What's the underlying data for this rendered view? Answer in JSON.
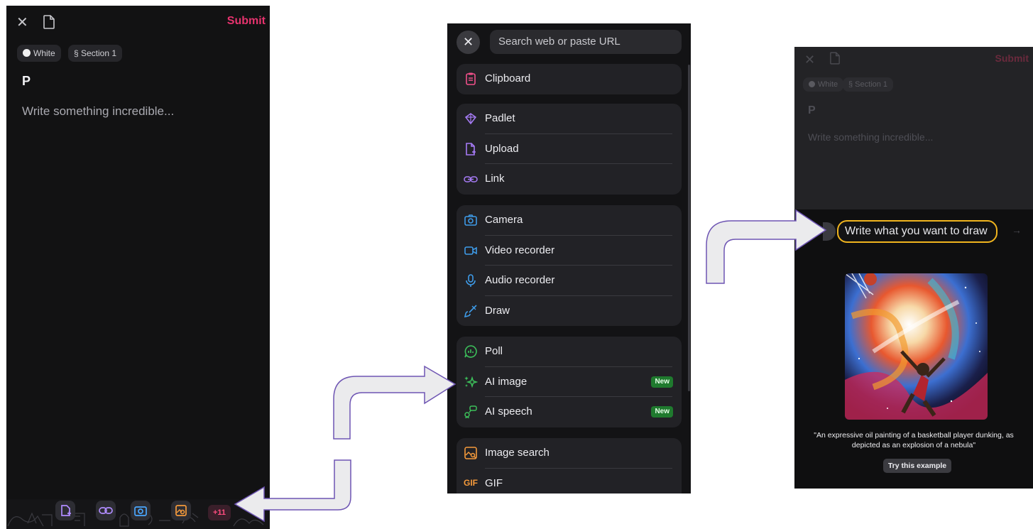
{
  "editor": {
    "submit_label": "Submit",
    "color_chip": "White",
    "section_chip": "§ Section 1",
    "title": "P",
    "body_placeholder": "Write something incredible...",
    "more_badge": "+11"
  },
  "menu": {
    "search_placeholder": "Search web or paste URL",
    "groups": [
      {
        "items": [
          {
            "label": "Clipboard",
            "icon": "clipboard-icon",
            "color": "#f0508a"
          }
        ]
      },
      {
        "items": [
          {
            "label": "Padlet",
            "icon": "padlet-icon",
            "color": "#a67bf5"
          },
          {
            "label": "Upload",
            "icon": "upload-icon",
            "color": "#a67bf5"
          },
          {
            "label": "Link",
            "icon": "link-icon",
            "color": "#a67bf5"
          }
        ]
      },
      {
        "items": [
          {
            "label": "Camera",
            "icon": "camera-icon",
            "color": "#3e9be8"
          },
          {
            "label": "Video recorder",
            "icon": "video-icon",
            "color": "#3e9be8"
          },
          {
            "label": "Audio recorder",
            "icon": "microphone-icon",
            "color": "#3e9be8"
          },
          {
            "label": "Draw",
            "icon": "brush-icon",
            "color": "#3e9be8"
          }
        ]
      },
      {
        "items": [
          {
            "label": "Poll",
            "icon": "poll-icon",
            "color": "#3cbf5a"
          },
          {
            "label": "AI image",
            "icon": "sparkle-icon",
            "color": "#3cbf5a",
            "badge": "New"
          },
          {
            "label": "AI speech",
            "icon": "speech-icon",
            "color": "#3cbf5a",
            "badge": "New"
          }
        ]
      },
      {
        "items": [
          {
            "label": "Image search",
            "icon": "image-search-icon",
            "color": "#f59a3b"
          },
          {
            "label": "GIF",
            "icon": "gif-icon",
            "color": "#f59a3b"
          }
        ]
      }
    ]
  },
  "ai_panel": {
    "submit_label": "Submit",
    "color_chip": "White",
    "section_chip": "§ Section 1",
    "title": "P",
    "body_placeholder": "Write something incredible...",
    "prompt_placeholder": "Write what you want to draw",
    "example_caption": "\"An expressive oil painting of a basketball player dunking, as depicted as an explosion of a nebula\"",
    "try_label": "Try this example"
  }
}
